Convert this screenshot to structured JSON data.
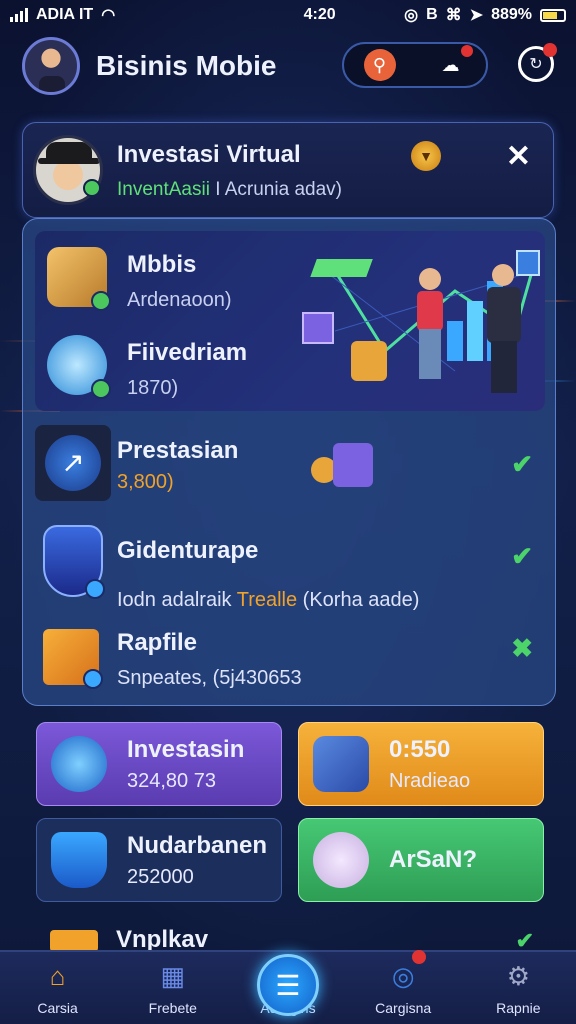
{
  "status_bar": {
    "carrier": "ADIA IT",
    "time": "4:20",
    "battery": "889%"
  },
  "header": {
    "title": "Bisinis Mobie"
  },
  "profile_card": {
    "title": "Investasi Virtual",
    "subtitle_green": "InventAasii",
    "subtitle_rest": " I Acrunia adav)"
  },
  "hero": {
    "items": [
      {
        "label": "Mbbis",
        "value": "Ardenaoon)"
      },
      {
        "label": "Fiivedriam",
        "value": "1870)"
      }
    ]
  },
  "list": [
    {
      "title": "Prestasian",
      "subtitle": "3,800)",
      "status": "check"
    },
    {
      "title": "Gidenturape",
      "subtitle_plain": "Iodn adalraik ",
      "subtitle_accent": "Trealle",
      "subtitle_tail": " (Korha aade)",
      "status": "check"
    },
    {
      "title": "Rapfile",
      "subtitle": "Snpeates, (5j430653",
      "status": "cross"
    }
  ],
  "tiles": [
    {
      "title": "Investasin",
      "value": "324,80 73",
      "color": "#6b49c9"
    },
    {
      "title": "0:550",
      "value": "Nradieao",
      "color": "#f0a22a"
    },
    {
      "title": "Nudarbanen",
      "value": "252000",
      "color": "#1c2f5c"
    },
    {
      "title": "ArSaN?",
      "value": "",
      "color": "#36b865"
    }
  ],
  "peek_row": {
    "title": "Vnplkav"
  },
  "bottom_nav": [
    {
      "label": "Carsia",
      "icon": "home-icon"
    },
    {
      "label": "Frebete",
      "icon": "calendar-icon"
    },
    {
      "label": "Adergins",
      "icon": "list-icon"
    },
    {
      "label": "Cargisna",
      "icon": "globe-icon"
    },
    {
      "label": "Rapnie",
      "icon": "gear-icon"
    }
  ],
  "colors": {
    "check": "#4cd36a",
    "accent_orange": "#f0a22a",
    "accent_green": "#5fe07a"
  }
}
